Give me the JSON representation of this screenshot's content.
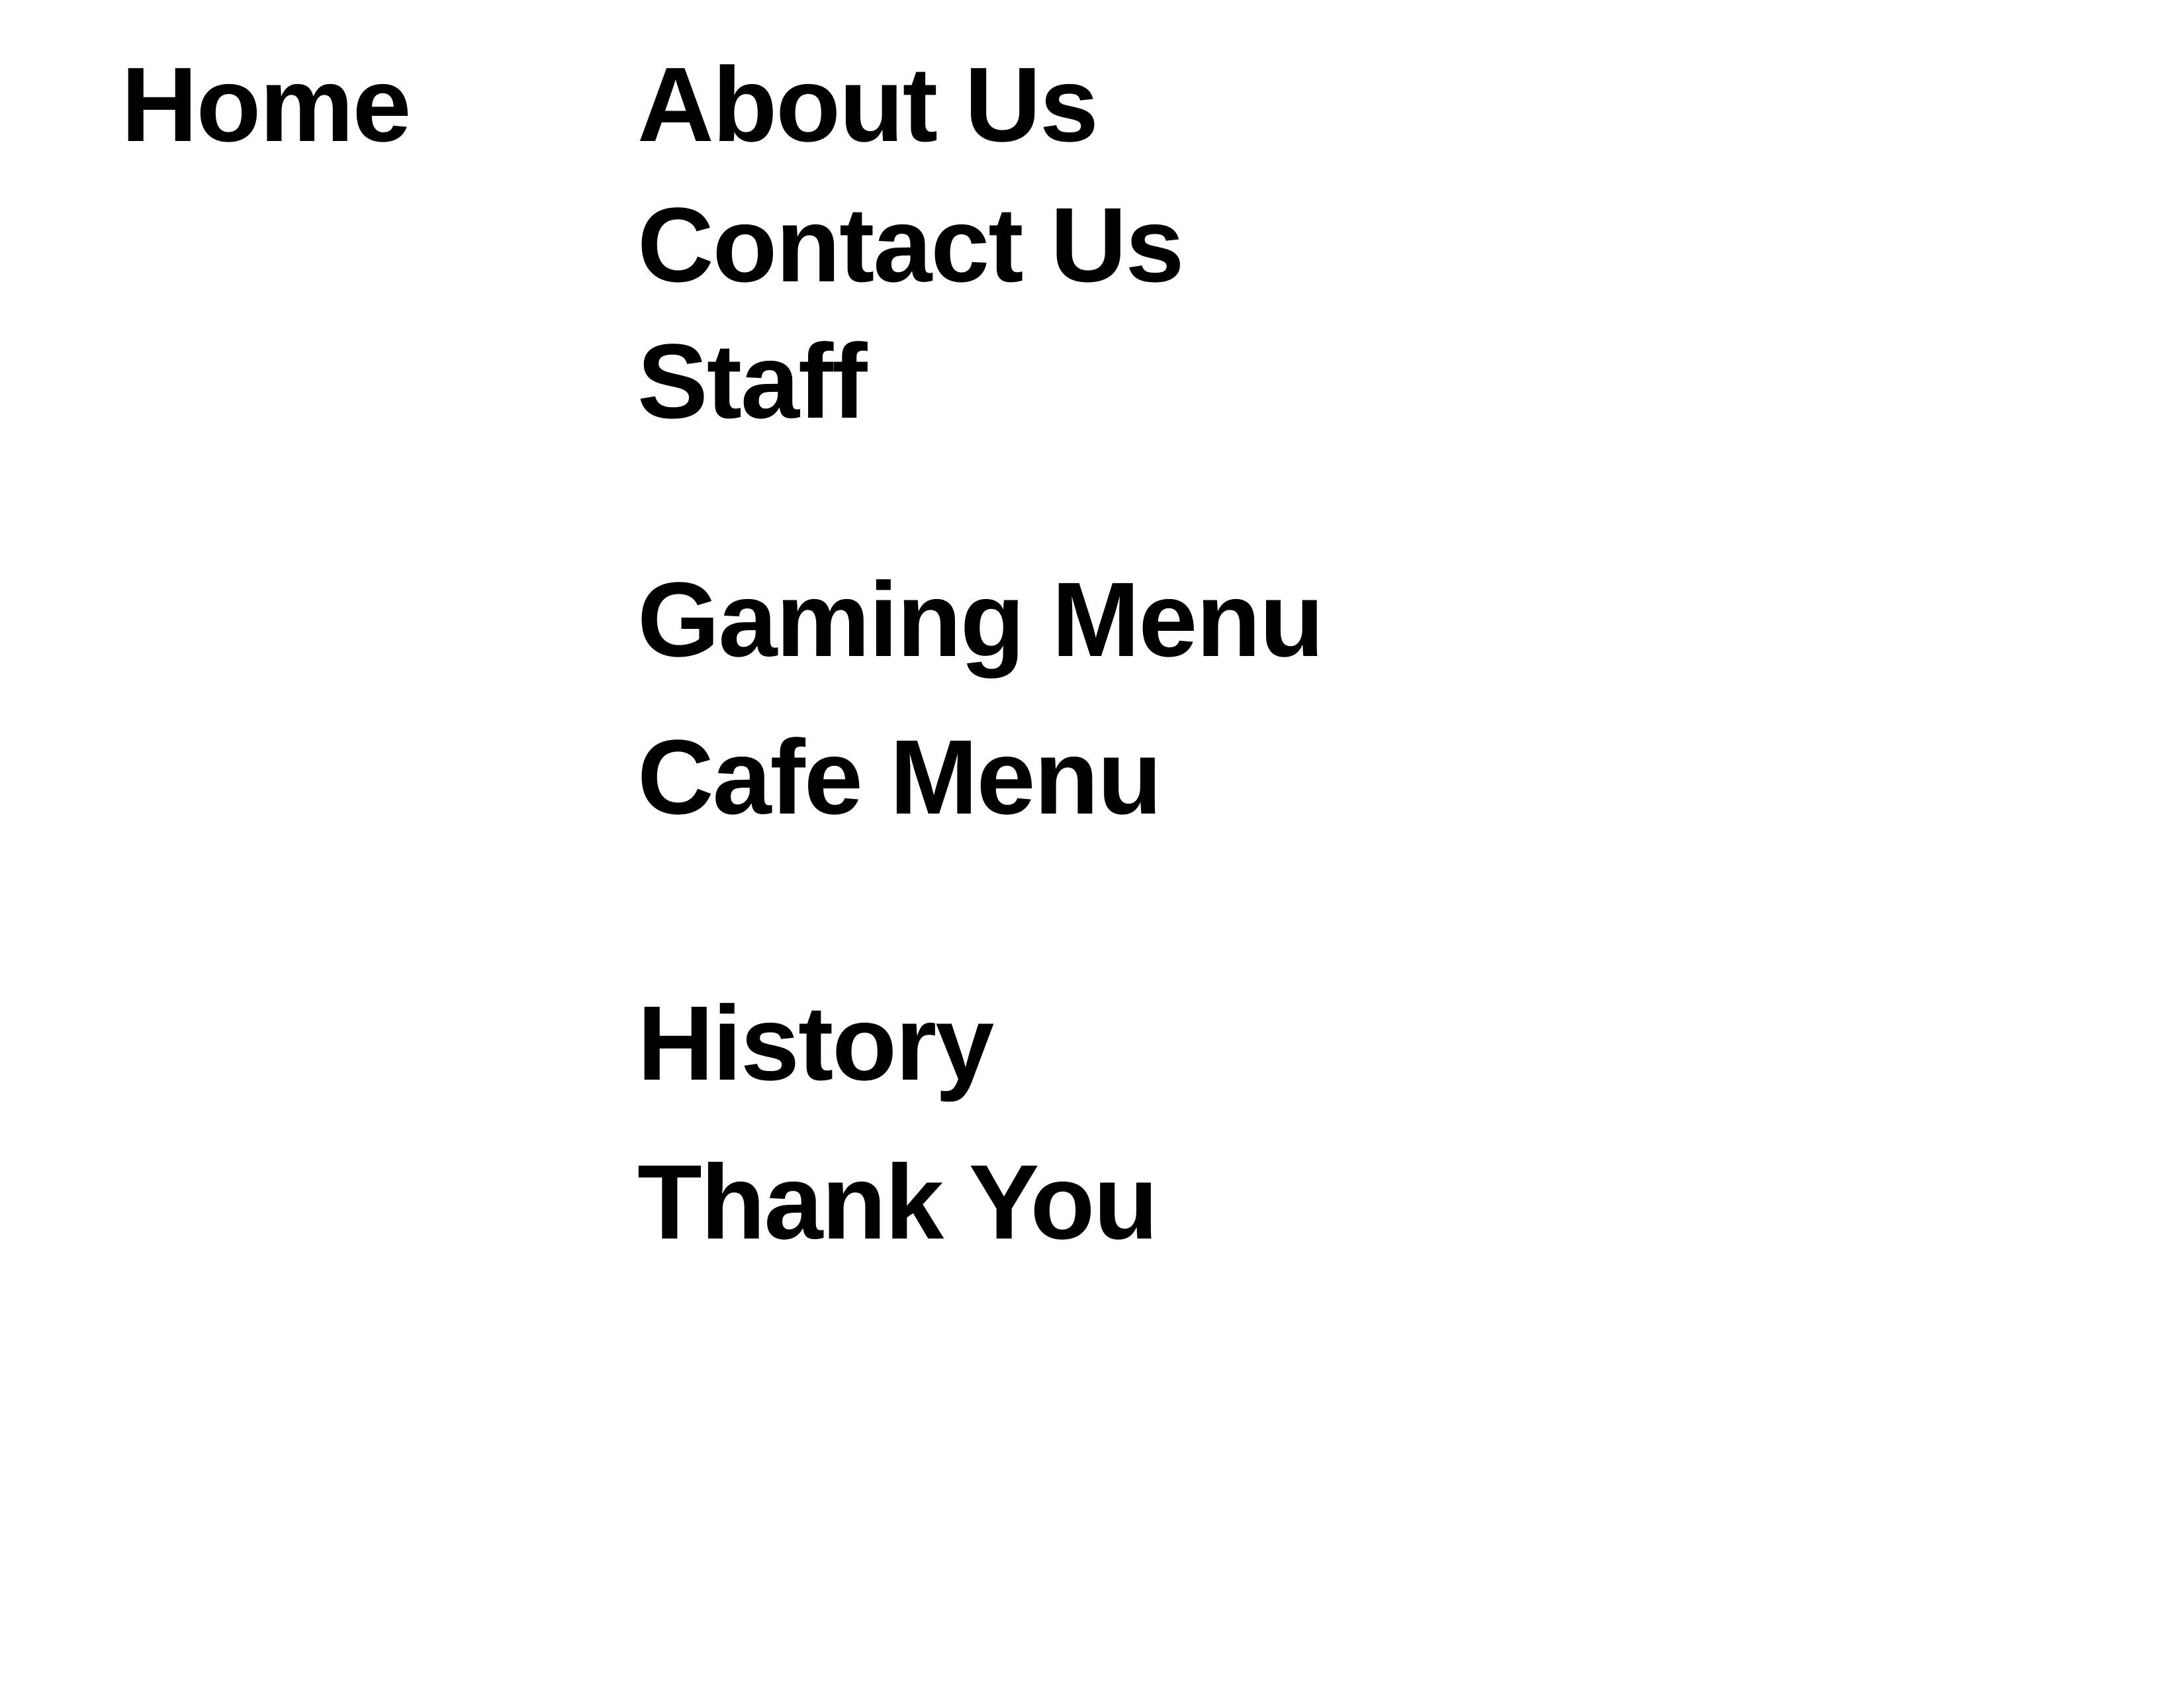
{
  "sitemap": {
    "root": {
      "label": "Home"
    },
    "groups": [
      {
        "items": [
          {
            "label": "About Us"
          },
          {
            "label": "Contact Us"
          },
          {
            "label": "Staff"
          }
        ]
      },
      {
        "items": [
          {
            "label": "Gaming Menu"
          },
          {
            "label": "Cafe Menu"
          }
        ]
      },
      {
        "items": [
          {
            "label": "History"
          },
          {
            "label": "Thank You"
          }
        ]
      }
    ]
  }
}
